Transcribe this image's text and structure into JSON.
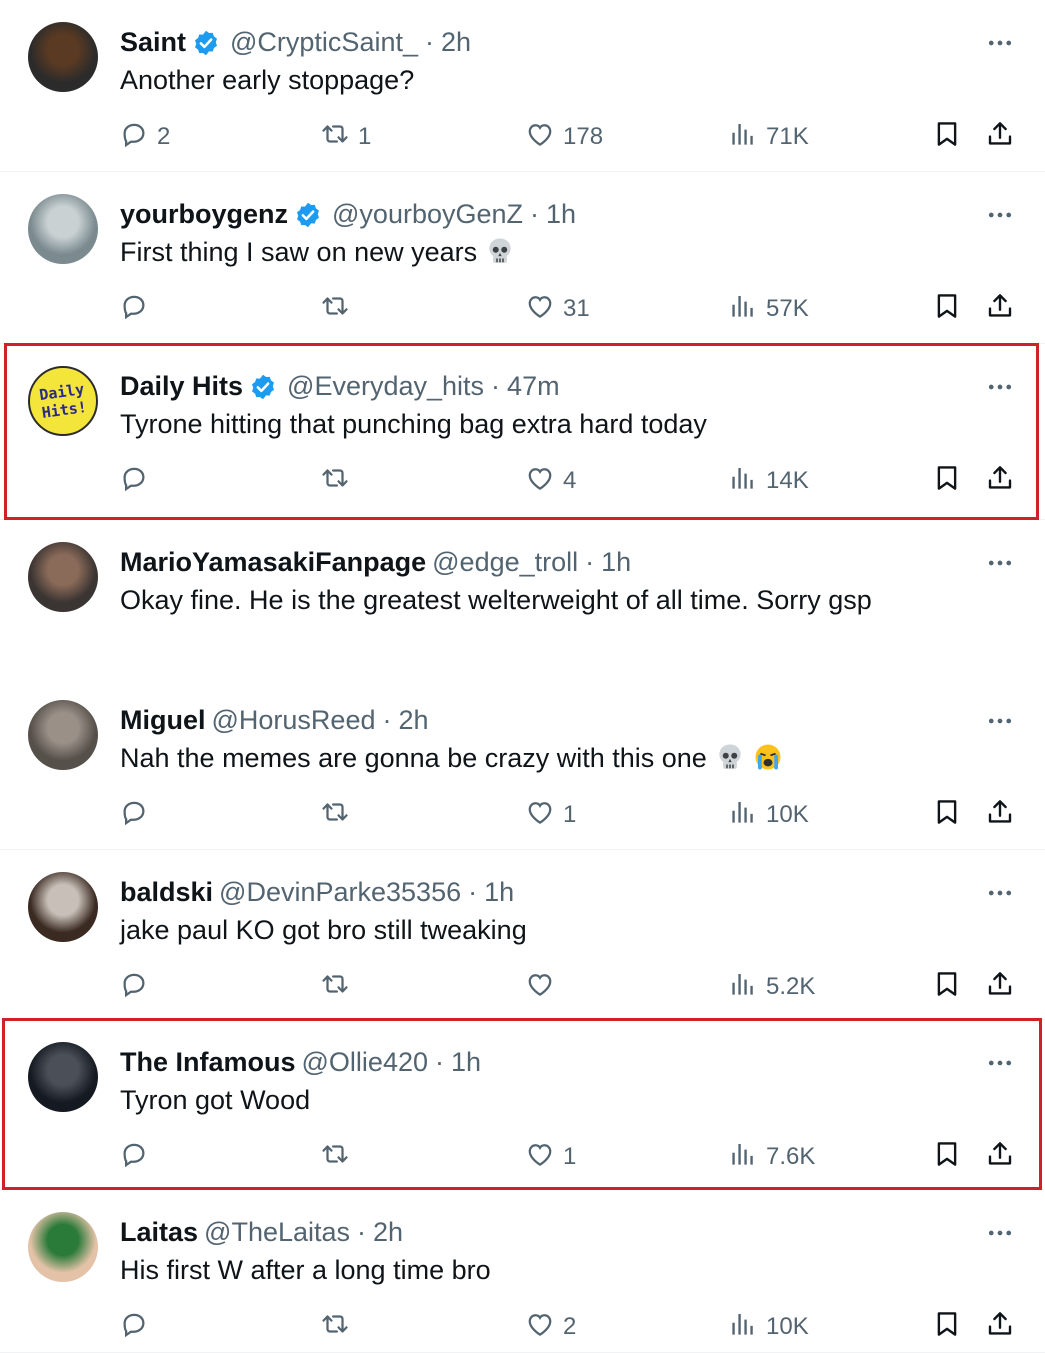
{
  "tweets": [
    {
      "name": "Saint",
      "verified": true,
      "handle": "@CrypticSaint_",
      "time": "2h",
      "text": "Another early stoppage?",
      "replies": "2",
      "retweets": "1",
      "likes": "178",
      "views": "71K",
      "emoji": []
    },
    {
      "name": "yourboygenz",
      "verified": true,
      "handle": "@yourboyGenZ",
      "time": "1h",
      "text": "First thing I saw on new years",
      "replies": "",
      "retweets": "",
      "likes": "31",
      "views": "57K",
      "emoji": [
        "skull-emoji"
      ]
    },
    {
      "name": "Daily Hits",
      "verified": true,
      "handle": "@Everyday_hits",
      "time": "47m",
      "text": "Tyrone hitting that punching bag extra hard today",
      "replies": "",
      "retweets": "",
      "likes": "4",
      "views": "14K",
      "emoji": [],
      "avatar_text": "Daily Hits!"
    },
    {
      "name": "MarioYamasakiFanpage",
      "verified": false,
      "handle": "@edge_troll",
      "time": "1h",
      "text": "Okay fine. He is the greatest welterweight of all time. Sorry gsp",
      "replies": "",
      "retweets": "",
      "likes": "",
      "views": "",
      "emoji": []
    },
    {
      "name": "Miguel",
      "verified": false,
      "handle": "@HorusReed",
      "time": "2h",
      "text": "Nah the memes are gonna be crazy with this one",
      "replies": "",
      "retweets": "",
      "likes": "1",
      "views": "10K",
      "emoji": [
        "skull-emoji",
        "crying-emoji"
      ]
    },
    {
      "name": "baldski",
      "verified": false,
      "handle": "@DevinParke35356",
      "time": "1h",
      "text": "jake paul KO got bro still tweaking",
      "replies": "",
      "retweets": "",
      "likes": "",
      "views": "5.2K",
      "emoji": []
    },
    {
      "name": "The Infamous",
      "verified": false,
      "handle": "@Ollie420",
      "time": "1h",
      "text": "Tyron got Wood",
      "replies": "",
      "retweets": "",
      "likes": "1",
      "views": "7.6K",
      "emoji": []
    },
    {
      "name": "Laitas",
      "verified": false,
      "handle": "@TheLaitas",
      "time": "2h",
      "text": "His first W after a long time bro",
      "replies": "",
      "retweets": "",
      "likes": "2",
      "views": "10K",
      "emoji": []
    }
  ],
  "separator": "·",
  "colors": {
    "accent": "#1d9bf0",
    "muted": "#536471",
    "highlight": "#d0202a",
    "text": "#0f1419"
  }
}
